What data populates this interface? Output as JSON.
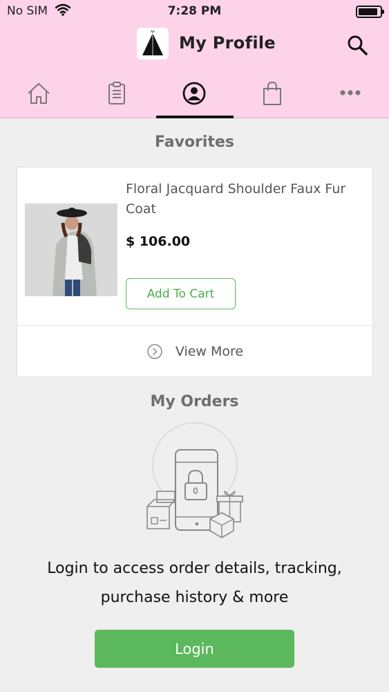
{
  "status_bar": {
    "carrier": "No SIM",
    "time": "7:28 PM",
    "battery_level": 0.9
  },
  "header": {
    "title": "My Profile"
  },
  "tabs": [
    {
      "name": "home",
      "icon": "home-icon",
      "active": false
    },
    {
      "name": "orders",
      "icon": "clipboard-icon",
      "active": false
    },
    {
      "name": "profile",
      "icon": "profile-icon",
      "active": true
    },
    {
      "name": "bag",
      "icon": "shopping-bag-icon",
      "active": false
    },
    {
      "name": "more",
      "icon": "more-icon",
      "active": false
    }
  ],
  "favorites": {
    "title": "Favorites",
    "product": {
      "name": "Floral Jacquard Shoulder Faux Fur Coat",
      "price": "$ 106.00",
      "add_to_cart_label": "Add To Cart"
    },
    "view_more_label": "View More"
  },
  "orders": {
    "title": "My Orders",
    "message_line1": "Login to access order details, tracking,",
    "message_line2": "purchase history & more",
    "login_label": "Login"
  },
  "colors": {
    "header_bg": "#fdd3e9",
    "accent_green": "#5cb85c",
    "page_bg": "#efefef"
  }
}
